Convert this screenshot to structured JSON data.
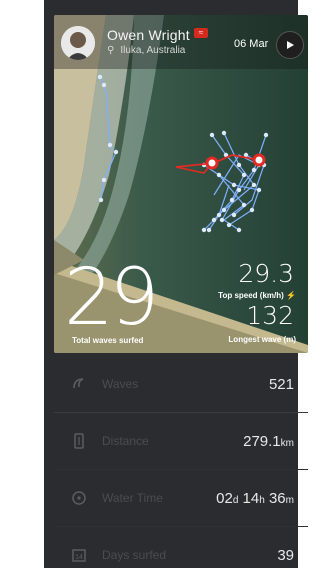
{
  "header": {
    "name": "Owen Wright",
    "location": "Iluka, Australia",
    "date": "06 Mar",
    "flag_icon": "red-wave-badge-icon",
    "avatar_icon": "surfer-avatar-icon"
  },
  "highlight": {
    "total_waves": "29",
    "total_waves_label": "Total waves surfed",
    "top_speed": "29.3",
    "top_speed_label": "Top speed (km/h)",
    "longest_wave": "132",
    "longest_wave_label": "Longest wave (m)"
  },
  "stats": [
    {
      "icon": "wave-icon",
      "label": "Waves",
      "value": "521"
    },
    {
      "icon": "distance-icon",
      "label": "Distance",
      "value": "279.1",
      "unit": "km"
    },
    {
      "icon": "clock-icon",
      "label": "Water Time",
      "value_d": "02",
      "value_h": "14",
      "value_m": "36"
    },
    {
      "icon": "calendar-icon",
      "label": "Days surfed",
      "value": "39"
    }
  ],
  "colors": {
    "accent": "#d42a1f",
    "track": "#7fb0ff",
    "panel": "#2a2c30"
  }
}
